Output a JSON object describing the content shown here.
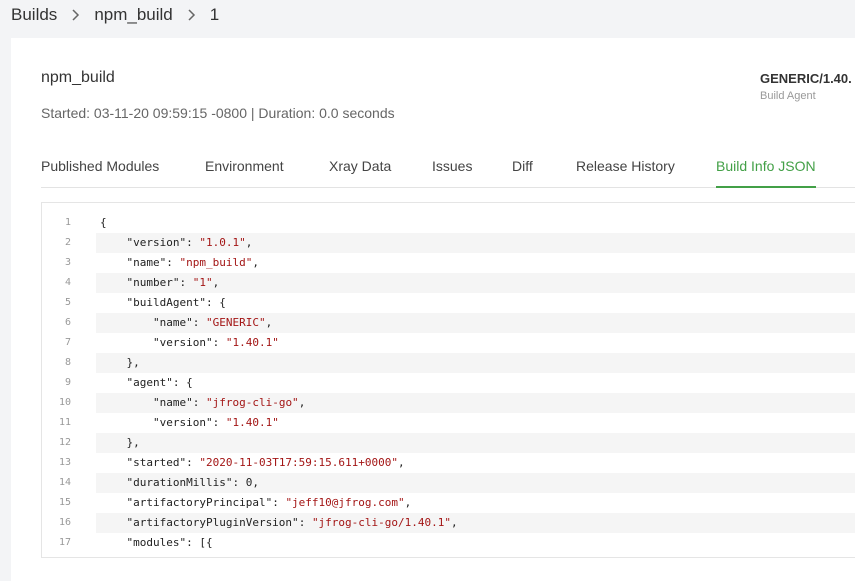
{
  "breadcrumb": {
    "items": [
      "Builds",
      "npm_build",
      "1"
    ]
  },
  "header": {
    "build_name": "npm_build",
    "meta": "Started: 03-11-20 09:59:15 -0800 | Duration: 0.0 seconds",
    "agent_name": "GENERIC/1.40.",
    "agent_label": "Build Agent"
  },
  "tabs": [
    {
      "label": "Published Modules"
    },
    {
      "label": "Environment"
    },
    {
      "label": "Xray Data"
    },
    {
      "label": "Issues"
    },
    {
      "label": "Diff"
    },
    {
      "label": "Release History"
    },
    {
      "label": "Build Info JSON",
      "active": true
    }
  ],
  "colors": {
    "accent": "#43a047",
    "string": "#a31515"
  },
  "code": {
    "lines": [
      {
        "no": "1",
        "segments": [
          {
            "t": "p",
            "v": "{"
          }
        ]
      },
      {
        "no": "2",
        "segments": [
          {
            "t": "k",
            "v": "    \"version\""
          },
          {
            "t": "p",
            "v": ": "
          },
          {
            "t": "s",
            "v": "\"1.0.1\""
          },
          {
            "t": "p",
            "v": ","
          }
        ]
      },
      {
        "no": "3",
        "segments": [
          {
            "t": "k",
            "v": "    \"name\""
          },
          {
            "t": "p",
            "v": ": "
          },
          {
            "t": "s",
            "v": "\"npm_build\""
          },
          {
            "t": "p",
            "v": ","
          }
        ]
      },
      {
        "no": "4",
        "segments": [
          {
            "t": "k",
            "v": "    \"number\""
          },
          {
            "t": "p",
            "v": ": "
          },
          {
            "t": "s",
            "v": "\"1\""
          },
          {
            "t": "p",
            "v": ","
          }
        ]
      },
      {
        "no": "5",
        "segments": [
          {
            "t": "k",
            "v": "    \"buildAgent\""
          },
          {
            "t": "p",
            "v": ": {"
          }
        ]
      },
      {
        "no": "6",
        "segments": [
          {
            "t": "k",
            "v": "        \"name\""
          },
          {
            "t": "p",
            "v": ": "
          },
          {
            "t": "s",
            "v": "\"GENERIC\""
          },
          {
            "t": "p",
            "v": ","
          }
        ]
      },
      {
        "no": "7",
        "segments": [
          {
            "t": "k",
            "v": "        \"version\""
          },
          {
            "t": "p",
            "v": ": "
          },
          {
            "t": "s",
            "v": "\"1.40.1\""
          }
        ]
      },
      {
        "no": "8",
        "segments": [
          {
            "t": "p",
            "v": "    },"
          }
        ]
      },
      {
        "no": "9",
        "segments": [
          {
            "t": "k",
            "v": "    \"agent\""
          },
          {
            "t": "p",
            "v": ": {"
          }
        ]
      },
      {
        "no": "10",
        "segments": [
          {
            "t": "k",
            "v": "        \"name\""
          },
          {
            "t": "p",
            "v": ": "
          },
          {
            "t": "s",
            "v": "\"jfrog-cli-go\""
          },
          {
            "t": "p",
            "v": ","
          }
        ]
      },
      {
        "no": "11",
        "segments": [
          {
            "t": "k",
            "v": "        \"version\""
          },
          {
            "t": "p",
            "v": ": "
          },
          {
            "t": "s",
            "v": "\"1.40.1\""
          }
        ]
      },
      {
        "no": "12",
        "segments": [
          {
            "t": "p",
            "v": "    },"
          }
        ]
      },
      {
        "no": "13",
        "segments": [
          {
            "t": "k",
            "v": "    \"started\""
          },
          {
            "t": "p",
            "v": ": "
          },
          {
            "t": "s",
            "v": "\"2020-11-03T17:59:15.611+0000\""
          },
          {
            "t": "p",
            "v": ","
          }
        ]
      },
      {
        "no": "14",
        "segments": [
          {
            "t": "k",
            "v": "    \"durationMillis\""
          },
          {
            "t": "p",
            "v": ": "
          },
          {
            "t": "n",
            "v": "0"
          },
          {
            "t": "p",
            "v": ","
          }
        ]
      },
      {
        "no": "15",
        "segments": [
          {
            "t": "k",
            "v": "    \"artifactoryPrincipal\""
          },
          {
            "t": "p",
            "v": ": "
          },
          {
            "t": "s",
            "v": "\"jeff10@jfrog.com\""
          },
          {
            "t": "p",
            "v": ","
          }
        ]
      },
      {
        "no": "16",
        "segments": [
          {
            "t": "k",
            "v": "    \"artifactoryPluginVersion\""
          },
          {
            "t": "p",
            "v": ": "
          },
          {
            "t": "s",
            "v": "\"jfrog-cli-go/1.40.1\""
          },
          {
            "t": "p",
            "v": ","
          }
        ]
      },
      {
        "no": "17",
        "segments": [
          {
            "t": "k",
            "v": "    \"modules\""
          },
          {
            "t": "p",
            "v": ": [{"
          }
        ]
      }
    ]
  }
}
